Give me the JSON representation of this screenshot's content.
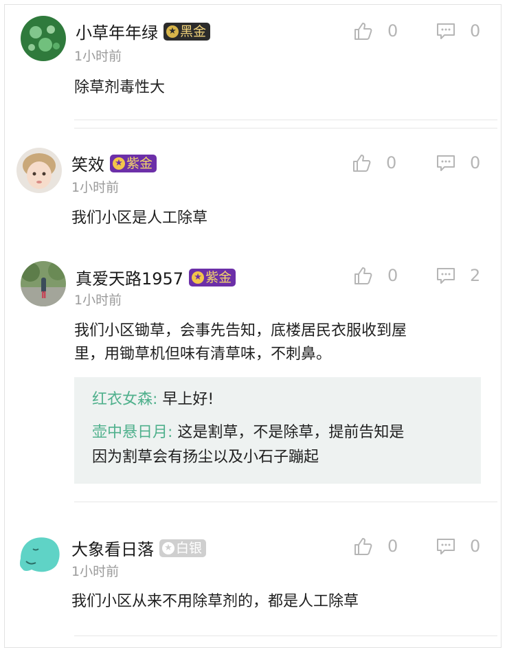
{
  "comments": [
    {
      "username": "小草年年绿",
      "badge": {
        "label": "黑金",
        "tier": "black"
      },
      "time": "1小时前",
      "text": "除草剂毒性大",
      "likes": "0",
      "replies": "0"
    },
    {
      "username": "笑效",
      "badge": {
        "label": "紫金",
        "tier": "purple"
      },
      "time": "1小时前",
      "text": "我们小区是人工除草",
      "likes": "0",
      "replies": "0"
    },
    {
      "username": "真爱天路1957",
      "badge": {
        "label": "紫金",
        "tier": "purple"
      },
      "time": "1小时前",
      "text_line1": "我们小区锄草，会事先告知，底楼居民衣服收到屋",
      "text_line2": "里，用锄草机但味有清草味，不刺鼻。",
      "likes": "0",
      "replies": "2",
      "sub_replies": [
        {
          "name": "红衣女森:",
          "text": "早上好!"
        },
        {
          "name": "壶中悬日月:",
          "text_line1": "这是割草，不是除草，提前告知是",
          "text_line2": "因为割草会有扬尘以及小石子蹦起"
        }
      ]
    },
    {
      "username": "大象看日落",
      "badge": {
        "label": "白银",
        "tier": "silver"
      },
      "time": "1小时前",
      "text": "我们小区从来不用除草剂的，都是人工除草",
      "likes": "0",
      "replies": "0"
    }
  ],
  "colors": {
    "reply_name": "#4fb08c",
    "action_gray": "#b5b5b5",
    "reply_bg": "#eef2f1"
  }
}
